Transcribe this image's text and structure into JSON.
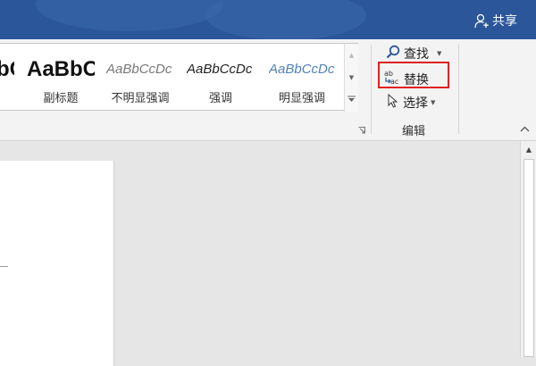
{
  "titlebar": {
    "share_label": "共享",
    "accent_color": "#2b579a"
  },
  "styles_gallery": {
    "items": [
      {
        "preview": "bC",
        "name": ""
      },
      {
        "preview": "AaBbC",
        "name": "副标题"
      },
      {
        "preview": "AaBbCcDc",
        "name": "不明显强调"
      },
      {
        "preview": "AaBbCcDc",
        "name": "强调"
      },
      {
        "preview": "AaBbCcDc",
        "name": "明显强调"
      }
    ]
  },
  "editing_group": {
    "find_label": "查找",
    "replace_label": "替换",
    "select_label": "选择",
    "group_label": "编辑"
  }
}
